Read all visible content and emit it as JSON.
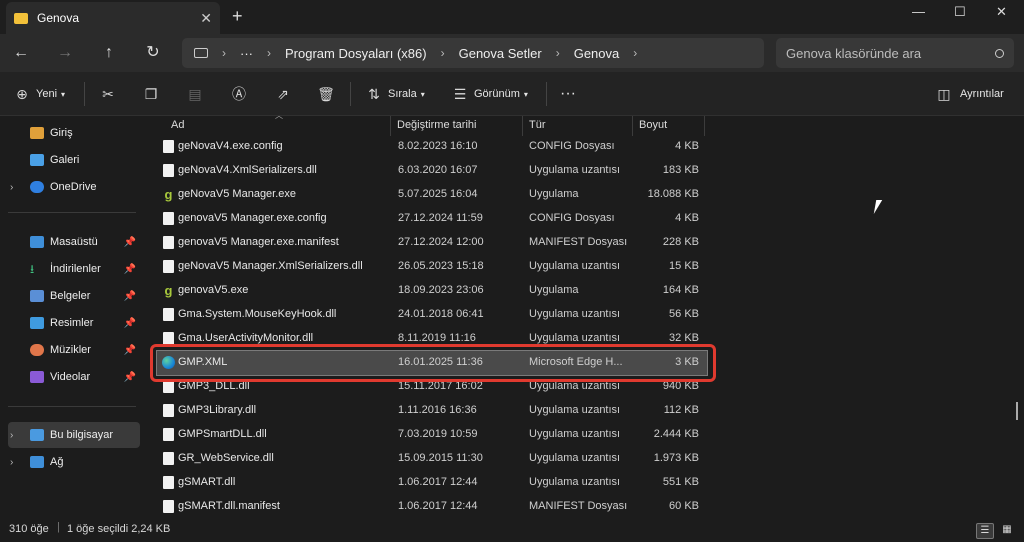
{
  "window": {
    "tab_title": "Genova",
    "close_tab": "✕",
    "new_tab": "+",
    "min": "—",
    "max": "☐",
    "close": "✕"
  },
  "nav": {
    "back": "←",
    "forward": "→",
    "up": "↑",
    "refresh": "↻",
    "breadcrumb": [
      "Program Dosyaları (x86)",
      "Genova Setler",
      "Genova"
    ],
    "more": "···",
    "search_placeholder": "Genova klasöründe ara"
  },
  "toolbar": {
    "new": "Yeni",
    "sort": "Sırala",
    "view": "Görünüm",
    "more": "···",
    "details": "Ayrıntılar"
  },
  "sidebar": {
    "home": "Giriş",
    "gallery": "Galeri",
    "onedrive": "OneDrive",
    "desktop": "Masaüstü",
    "downloads": "İndirilenler",
    "documents": "Belgeler",
    "pictures": "Resimler",
    "music": "Müzikler",
    "videos": "Videolar",
    "this_pc": "Bu bilgisayar",
    "network": "Ağ"
  },
  "columns": {
    "name": "Ad",
    "date": "Değiştirme tarihi",
    "type": "Tür",
    "size": "Boyut"
  },
  "files": [
    {
      "name": "geNovaV4.exe.config",
      "date": "8.02.2023 16:10",
      "type": "CONFIG Dosyası",
      "size": "4 KB",
      "icon": "file"
    },
    {
      "name": "geNovaV4.XmlSerializers.dll",
      "date": "6.03.2020 16:07",
      "type": "Uygulama uzantısı",
      "size": "183 KB",
      "icon": "file"
    },
    {
      "name": "geNovaV5 Manager.exe",
      "date": "5.07.2025 16:04",
      "type": "Uygulama",
      "size": "18.088 KB",
      "icon": "exe"
    },
    {
      "name": "genovaV5 Manager.exe.config",
      "date": "27.12.2024 11:59",
      "type": "CONFIG Dosyası",
      "size": "4 KB",
      "icon": "file"
    },
    {
      "name": "genovaV5 Manager.exe.manifest",
      "date": "27.12.2024 12:00",
      "type": "MANIFEST Dosyası",
      "size": "228 KB",
      "icon": "file"
    },
    {
      "name": "geNovaV5 Manager.XmlSerializers.dll",
      "date": "26.05.2023 15:18",
      "type": "Uygulama uzantısı",
      "size": "15 KB",
      "icon": "file"
    },
    {
      "name": "genovaV5.exe",
      "date": "18.09.2023 23:06",
      "type": "Uygulama",
      "size": "164 KB",
      "icon": "exe"
    },
    {
      "name": "Gma.System.MouseKeyHook.dll",
      "date": "24.01.2018 06:41",
      "type": "Uygulama uzantısı",
      "size": "56 KB",
      "icon": "file"
    },
    {
      "name": "Gma.UserActivityMonitor.dll",
      "date": "8.11.2019 11:16",
      "type": "Uygulama uzantısı",
      "size": "32 KB",
      "icon": "file"
    },
    {
      "name": "GMP.XML",
      "date": "16.01.2025 11:36",
      "type": "Microsoft Edge H...",
      "size": "3 KB",
      "icon": "edge",
      "selected": true
    },
    {
      "name": "GMP3_DLL.dll",
      "date": "15.11.2017 16:02",
      "type": "Uygulama uzantısı",
      "size": "940 KB",
      "icon": "file"
    },
    {
      "name": "GMP3Library.dll",
      "date": "1.11.2016 16:36",
      "type": "Uygulama uzantısı",
      "size": "112 KB",
      "icon": "file"
    },
    {
      "name": "GMPSmartDLL.dll",
      "date": "7.03.2019 10:59",
      "type": "Uygulama uzantısı",
      "size": "2.444 KB",
      "icon": "file"
    },
    {
      "name": "GR_WebService.dll",
      "date": "15.09.2015 11:30",
      "type": "Uygulama uzantısı",
      "size": "1.973 KB",
      "icon": "file"
    },
    {
      "name": "gSMART.dll",
      "date": "1.06.2017 12:44",
      "type": "Uygulama uzantısı",
      "size": "551 KB",
      "icon": "file"
    },
    {
      "name": "gSMART.dll.manifest",
      "date": "1.06.2017 12:44",
      "type": "MANIFEST Dosyası",
      "size": "60 KB",
      "icon": "file"
    }
  ],
  "status": {
    "count": "310 öğe",
    "selected": "1 öğe seçildi  2,24 KB"
  },
  "colors": {
    "highlight": "#e03a2f",
    "accent": "#f3c13a"
  }
}
